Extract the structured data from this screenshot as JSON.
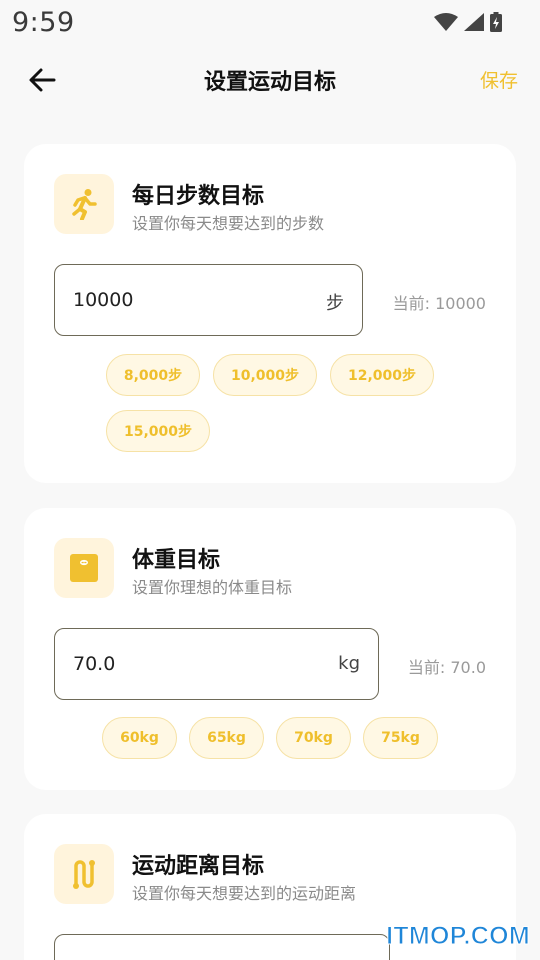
{
  "status_bar": {
    "time": "9:59",
    "icons": [
      "wifi-icon",
      "signal-icon",
      "battery-charging-icon"
    ]
  },
  "app_bar": {
    "back_icon": "arrow-left-icon",
    "title": "设置运动目标",
    "save_label": "保存"
  },
  "colors": {
    "accent": "#f0c030",
    "chip_bg": "#fff8e4",
    "chip_border": "#f6e2a6",
    "icon_bg": "#fff4dc",
    "page_bg": "#f8f8f8"
  },
  "steps_goal": {
    "icon": "running-person-icon",
    "title": "每日步数目标",
    "subtitle": "设置你每天想要达到的步数",
    "input_value": "10000",
    "unit": "步",
    "current": "当前: 10000",
    "presets": [
      "8,000步",
      "10,000步",
      "12,000步",
      "15,000步"
    ]
  },
  "weight_goal": {
    "icon": "scale-icon",
    "title": "体重目标",
    "subtitle": "设置你理想的体重目标",
    "input_value": "70.0",
    "unit": "kg",
    "current": "当前: 70.0",
    "presets": [
      "60kg",
      "65kg",
      "70kg",
      "75kg"
    ]
  },
  "distance_goal": {
    "icon": "route-icon",
    "title": "运动距离目标",
    "subtitle": "设置你每天想要达到的运动距离"
  },
  "watermark": "ITMOP.COM"
}
